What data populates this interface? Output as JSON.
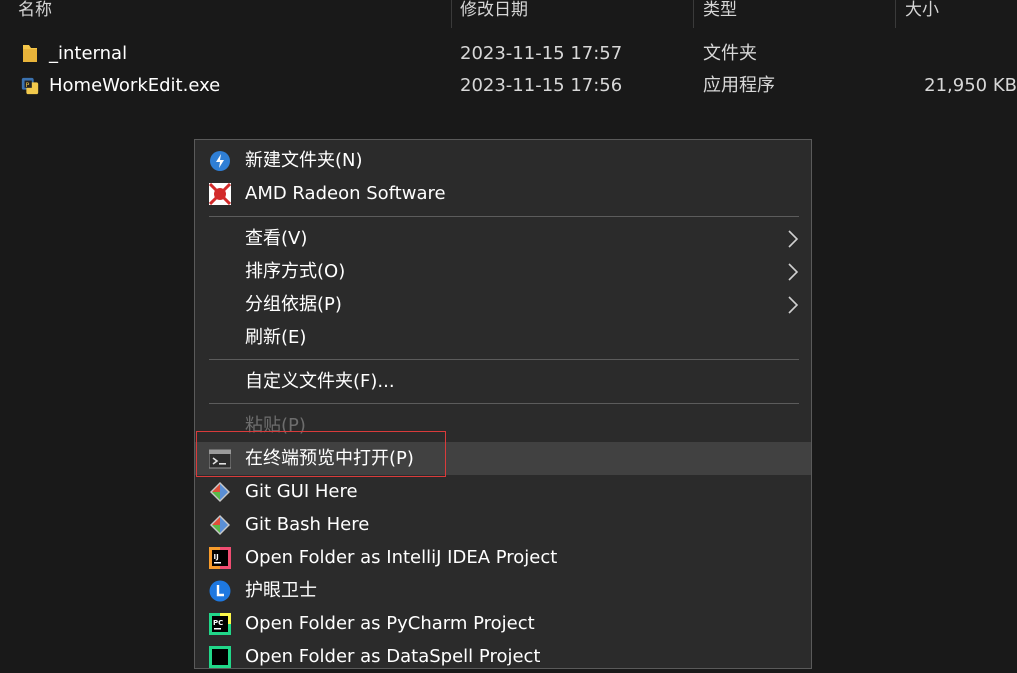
{
  "columns": {
    "name": "名称",
    "modified": "修改日期",
    "type": "类型",
    "size": "大小"
  },
  "files": [
    {
      "name": "_internal",
      "modified": "2023-11-15 17:57",
      "type": "文件夹",
      "size": "",
      "icon": "folder-icon"
    },
    {
      "name": "HomeWorkEdit.exe",
      "modified": "2023-11-15 17:56",
      "type": "应用程序",
      "size": "21,950 KB",
      "icon": "python-exe-icon"
    }
  ],
  "menu": {
    "items": [
      {
        "label": "新建文件夹(N)",
        "icon": "new-folder-icon"
      },
      {
        "label": "AMD Radeon Software",
        "icon": "amd-radeon-icon"
      },
      {
        "label": "查看(V)",
        "submenu": true
      },
      {
        "label": "排序方式(O)",
        "submenu": true
      },
      {
        "label": "分组依据(P)",
        "submenu": true
      },
      {
        "label": "刷新(E)"
      },
      {
        "label": "自定义文件夹(F)..."
      },
      {
        "label": "粘贴(P)",
        "disabled": true
      },
      {
        "label": "在终端预览中打开(P)",
        "icon": "terminal-icon",
        "hovered": true
      },
      {
        "label": "Git GUI Here",
        "icon": "git-icon"
      },
      {
        "label": "Git Bash Here",
        "icon": "git-icon"
      },
      {
        "label": "Open Folder as IntelliJ IDEA Project",
        "icon": "intellij-icon"
      },
      {
        "label": "护眼卫士",
        "icon": "eye-guard-icon"
      },
      {
        "label": "Open Folder as PyCharm Project",
        "icon": "pycharm-icon"
      },
      {
        "label": "Open Folder as DataSpell Project",
        "icon": "dataspell-icon"
      }
    ]
  },
  "colors": {
    "background": "#191919",
    "menu_background": "#2b2b2b",
    "hover_background": "#414141",
    "highlight_border": "#d93b3b",
    "folder_yellow": "#f5c74a"
  }
}
